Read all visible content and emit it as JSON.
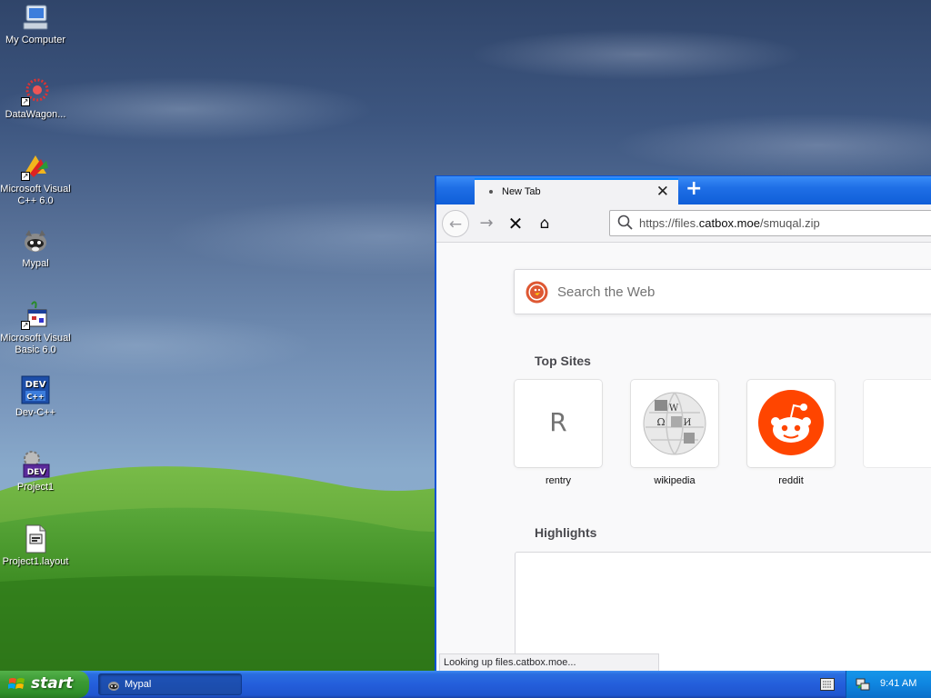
{
  "desktop": {
    "icons": [
      {
        "label": "My Computer",
        "icon": "computer-icon"
      },
      {
        "label": "DataWagon...",
        "icon": "datawagon-icon"
      },
      {
        "label": "Microsoft Visual C++ 6.0",
        "icon": "visual-cpp-icon"
      },
      {
        "label": "Mypal",
        "icon": "mypal-icon"
      },
      {
        "label": "Microsoft Visual Basic 6.0",
        "icon": "visual-basic-icon"
      },
      {
        "label": "Dev-C++",
        "icon": "devcpp-icon"
      },
      {
        "label": "Project1",
        "icon": "devcpp-project-icon"
      },
      {
        "label": "Project1.layout",
        "icon": "layout-file-icon"
      }
    ]
  },
  "browser": {
    "tab": {
      "title": "New Tab",
      "close_glyph": "✕"
    },
    "new_tab_glyph": "+",
    "nav": {
      "back": "←",
      "forward": "→",
      "stop": "✕",
      "home": "⌂"
    },
    "url": {
      "prefix": "https://files.",
      "domain": "catbox.moe",
      "path": "/smuqal.zip"
    },
    "search": {
      "placeholder": "Search the Web"
    },
    "top_sites_title": "Top Sites",
    "top_sites": [
      {
        "label": "rentry",
        "letter": "R"
      },
      {
        "label": "wikipedia",
        "icon": "wikipedia-globe-icon"
      },
      {
        "label": "reddit",
        "icon": "reddit-icon"
      },
      {
        "label": "",
        "icon": "empty-tile"
      }
    ],
    "highlights_title": "Highlights",
    "status": "Looking up files.catbox.moe..."
  },
  "taskbar": {
    "start_label": "start",
    "tasks": [
      {
        "label": "Mypal",
        "icon": "mypal-icon"
      }
    ],
    "clock": "9:41 AM"
  },
  "colors": {
    "taskbar_blue": "#245edb",
    "start_green": "#3c9a33",
    "tab_accent": "#0a84ff",
    "reddit_orange": "#ff4500"
  }
}
